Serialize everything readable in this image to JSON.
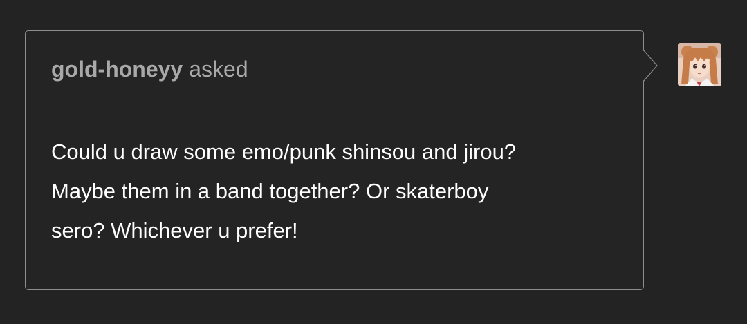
{
  "ask": {
    "asker": "gold-honeyy",
    "verb": "asked",
    "question_lines": [
      "Could u draw some emo/punk shinsou and jirou?",
      "Maybe them in a band together? Or skaterboy",
      "sero? Whichever u prefer!"
    ]
  },
  "avatar": {
    "icon": "anime-girl-avatar-icon"
  },
  "colors": {
    "background": "#232323",
    "bubble_border": "#8e8e8e",
    "asker_text": "#a9a9a9",
    "question_text": "#ffffff"
  }
}
